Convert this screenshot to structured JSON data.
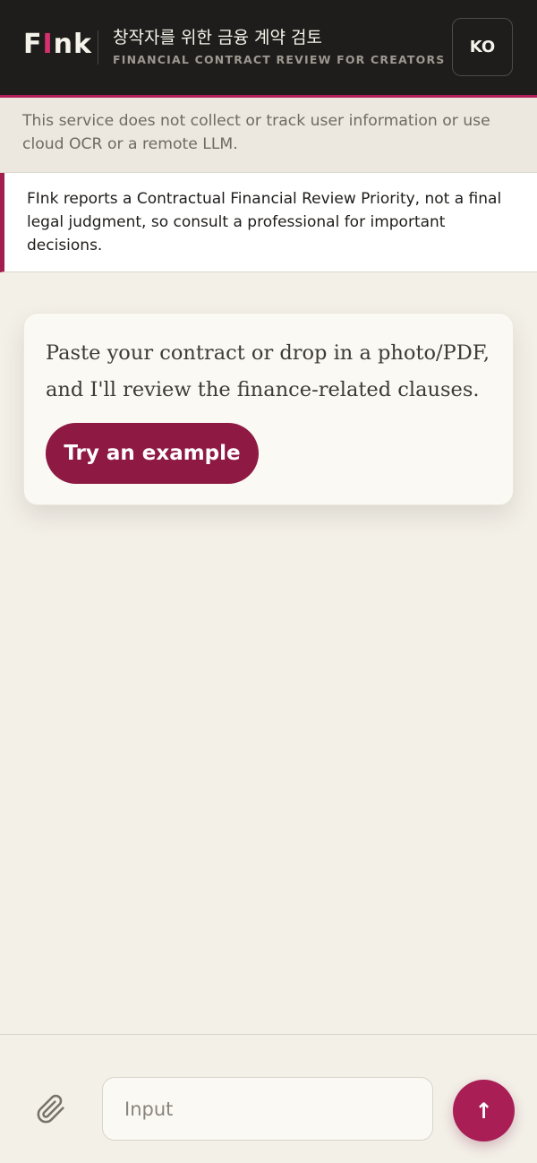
{
  "header": {
    "logo_pre": "F",
    "logo_accent": "I",
    "logo_post": "nk",
    "title": "창작자를 위한 금융 계약 검토",
    "subtitle": "FINANCIAL CONTRACT REVIEW FOR CREATORS",
    "language_label": "KO"
  },
  "privacy_notice": "This service does not collect or track user information or use cloud OCR or a remote LLM.",
  "disclaimer": "FInk reports a Contractual Financial Review Priority, not a final legal judgment, so consult a professional for important decisions.",
  "intro": {
    "message": "Paste your contract or drop in a photo/PDF, and I'll review the finance-related clauses.",
    "example_button": "Try an example"
  },
  "composer": {
    "placeholder": "Input",
    "value": "",
    "attach_icon": "paperclip-icon",
    "send_icon": "arrow-up-icon",
    "send_symbol": "↑"
  },
  "colors": {
    "header_bg": "#1f1d1b",
    "accent": "#a81e55",
    "button": "#8e1a43",
    "page_bg": "#f3f0e8"
  }
}
